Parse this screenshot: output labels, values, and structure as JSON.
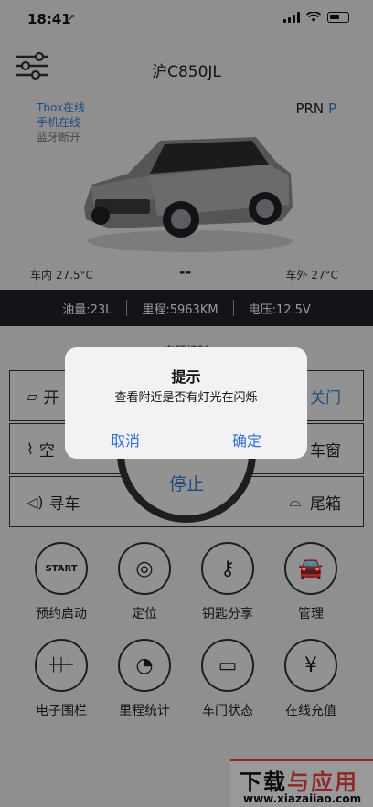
{
  "status": {
    "time": "18:41",
    "location_glyph": "➚"
  },
  "header": {
    "plate": "沪C850JL"
  },
  "connection": {
    "tbox": "Tbox在线",
    "phone": "手机在线",
    "bluetooth": "蓝牙断开"
  },
  "gear": {
    "label": "PRN",
    "current": "P"
  },
  "temperature": {
    "inside": "车内 27.5°C",
    "middle": "--",
    "outside": "车外 27°C"
  },
  "info": {
    "fuel": "油量:23L",
    "mileage": "里程:5963KM",
    "voltage": "电压:12.5V"
  },
  "controls": {
    "title": "车辆控制",
    "unlock": "开",
    "close_door": "关门",
    "ac": "空",
    "window": "车窗",
    "find_car": "寻车",
    "trunk": "尾箱",
    "stop": "停止"
  },
  "grid": [
    {
      "label": "预约启动",
      "icon": "start-gauge-icon",
      "glyph": "START"
    },
    {
      "label": "定位",
      "icon": "locate-icon",
      "glyph": "◎"
    },
    {
      "label": "钥匙分享",
      "icon": "key-icon",
      "glyph": "⚷"
    },
    {
      "label": "管理",
      "icon": "car-manage-icon",
      "glyph": "🚘"
    },
    {
      "label": "电子围栏",
      "icon": "fence-icon",
      "glyph": "┼┼┼"
    },
    {
      "label": "里程统计",
      "icon": "speedometer-icon",
      "glyph": "◔"
    },
    {
      "label": "车门状态",
      "icon": "door-icon",
      "glyph": "▭"
    },
    {
      "label": "在线充值",
      "icon": "yen-icon",
      "glyph": "¥"
    }
  ],
  "watermark": {
    "top_a": "下载",
    "top_b": "与应用",
    "bottom": "www.xiazaiiao.com"
  },
  "dialog": {
    "title": "提示",
    "message": "查看附近是否有灯光在闪烁",
    "cancel": "取消",
    "confirm": "确定"
  },
  "colors": {
    "accent": "#3a7fd0",
    "infobar": "#1e2228",
    "dialog_button": "#2f6fd6"
  }
}
